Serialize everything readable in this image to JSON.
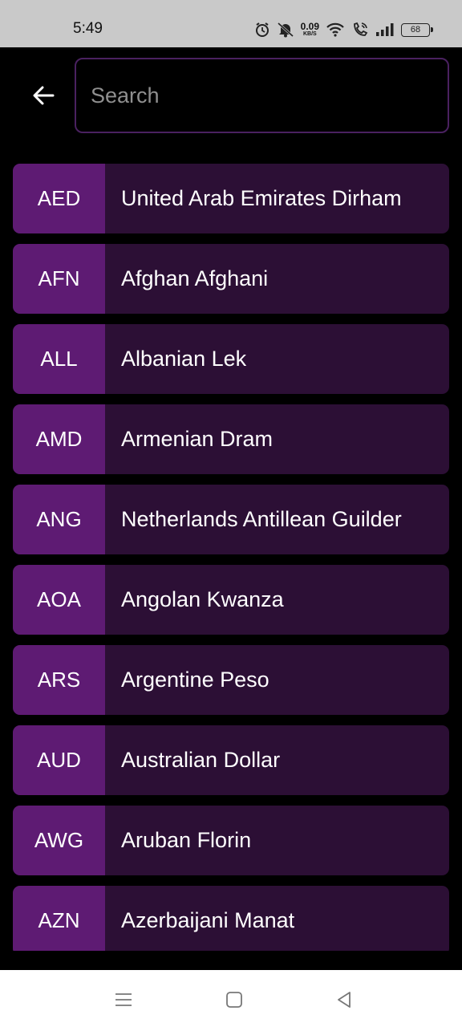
{
  "status_bar": {
    "time": "5:49",
    "net_speed_value": "0.09",
    "net_speed_unit": "KB/S",
    "battery": "68",
    "icons": [
      "alarm-icon",
      "mute-icon",
      "wifi-icon",
      "wifi-call-icon",
      "signal-icon",
      "battery-icon"
    ]
  },
  "header": {
    "back_icon": "arrow-left-icon",
    "search_placeholder": "Search",
    "search_value": ""
  },
  "currencies": [
    {
      "code": "AED",
      "name": "United Arab Emirates Dirham"
    },
    {
      "code": "AFN",
      "name": "Afghan Afghani"
    },
    {
      "code": "ALL",
      "name": "Albanian Lek"
    },
    {
      "code": "AMD",
      "name": "Armenian Dram"
    },
    {
      "code": "ANG",
      "name": "Netherlands Antillean Guilder"
    },
    {
      "code": "AOA",
      "name": "Angolan Kwanza"
    },
    {
      "code": "ARS",
      "name": "Argentine Peso"
    },
    {
      "code": "AUD",
      "name": "Australian Dollar"
    },
    {
      "code": "AWG",
      "name": "Aruban Florin"
    },
    {
      "code": "AZN",
      "name": "Azerbaijani Manat"
    }
  ],
  "nav_bar": {
    "icons": [
      "menu-icon",
      "home-icon",
      "back-triangle-icon"
    ]
  },
  "colors": {
    "code_bg": "#5e1b73",
    "row_bg": "#2c0f35",
    "search_border": "#4a2160",
    "background": "#000000"
  }
}
